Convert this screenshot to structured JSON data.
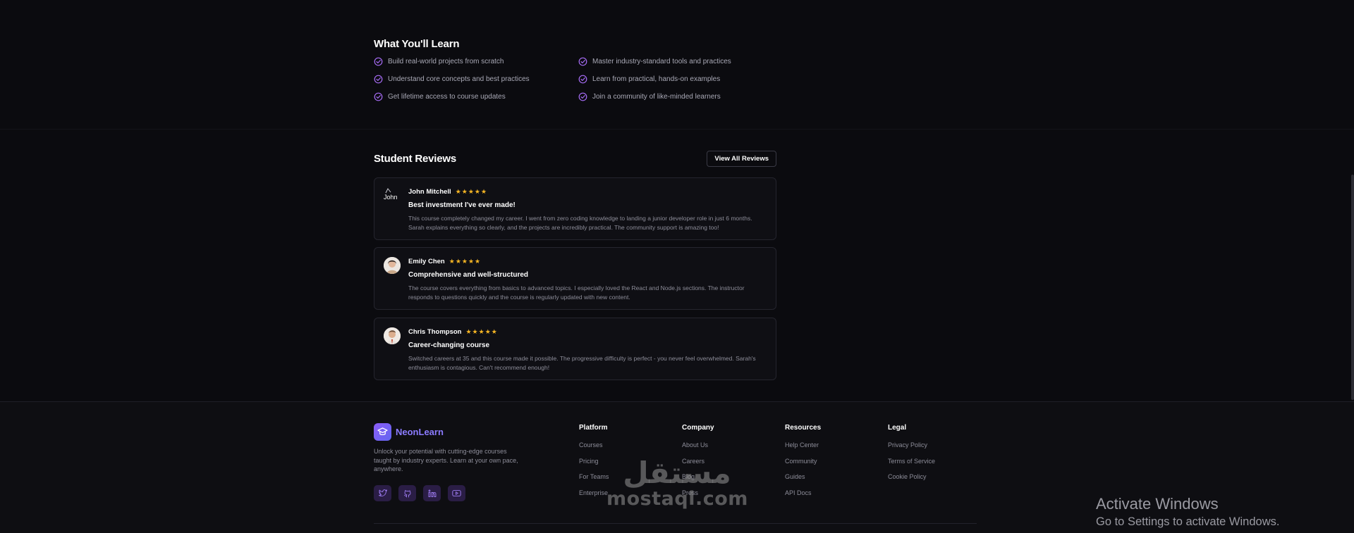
{
  "learn": {
    "title": "What You'll Learn",
    "items": [
      "Build real-world projects from scratch",
      "Master industry-standard tools and practices",
      "Understand core concepts and best practices",
      "Learn from practical, hands-on examples",
      "Get lifetime access to course updates",
      "Join a community of like-minded learners"
    ]
  },
  "reviews": {
    "title": "Student Reviews",
    "view_all_label": "View All Reviews",
    "items": [
      {
        "name": "John Mitchell",
        "avatar_alt": "John",
        "rating": 5,
        "stars": "★★★★★",
        "title": "Best investment I've ever made!",
        "text": "This course completely changed my career. I went from zero coding knowledge to landing a junior developer role in just 6 months. Sarah explains everything so clearly, and the projects are incredibly practical. The community support is amazing too!"
      },
      {
        "name": "Emily Chen",
        "rating": 5,
        "stars": "★★★★★",
        "title": "Comprehensive and well-structured",
        "text": "The course covers everything from basics to advanced topics. I especially loved the React and Node.js sections. The instructor responds to questions quickly and the course is regularly updated with new content."
      },
      {
        "name": "Chris Thompson",
        "rating": 5,
        "stars": "★★★★★",
        "title": "Career-changing course",
        "text": "Switched careers at 35 and this course made it possible. The progressive difficulty is perfect - you never feel overwhelmed. Sarah's enthusiasm is contagious. Can't recommend enough!"
      }
    ]
  },
  "footer": {
    "brand_name": "NeonLearn",
    "brand_description": "Unlock your potential with cutting-edge courses taught by industry experts. Learn at your own pace, anywhere.",
    "socials": [
      "twitter-icon",
      "github-icon",
      "linkedin-icon",
      "youtube-icon"
    ],
    "columns": [
      {
        "title": "Platform",
        "links": [
          "Courses",
          "Pricing",
          "For Teams",
          "Enterprise"
        ]
      },
      {
        "title": "Company",
        "links": [
          "About Us",
          "Careers",
          "Blog",
          "Press"
        ]
      },
      {
        "title": "Resources",
        "links": [
          "Help Center",
          "Community",
          "Guides",
          "API Docs"
        ]
      },
      {
        "title": "Legal",
        "links": [
          "Privacy Policy",
          "Terms of Service",
          "Cookie Policy"
        ]
      }
    ]
  },
  "watermark": {
    "arabic": "مستقل",
    "latin": "mostaql.com"
  },
  "os_overlay": {
    "line1": "Activate Windows",
    "line2": "Go to Settings to activate Windows."
  },
  "colors": {
    "accent": "#8b5cf6",
    "brand_text": "#8b7bff",
    "star": "#f5b524",
    "background": "#0b0b0f"
  }
}
